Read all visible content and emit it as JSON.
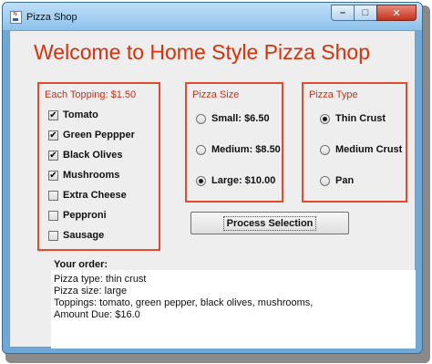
{
  "window": {
    "title": "Pizza Shop",
    "controls": {
      "minimize": "–",
      "maximize": "□",
      "close": "✕"
    },
    "colors": {
      "accent": "#d8300a",
      "panel_border": "#e24b2c"
    }
  },
  "welcome": "Welcome to Home Style Pizza Shop",
  "toppings": {
    "title": "Each Topping: $1.50",
    "items": [
      {
        "label": "Tomato",
        "checked": true
      },
      {
        "label": "Green Peppper",
        "checked": true
      },
      {
        "label": "Black Olives",
        "checked": true
      },
      {
        "label": "Mushrooms",
        "checked": true
      },
      {
        "label": "Extra Cheese",
        "checked": false
      },
      {
        "label": "Pepproni",
        "checked": false
      },
      {
        "label": "Sausage",
        "checked": false
      }
    ]
  },
  "size": {
    "title": "Pizza Size",
    "options": [
      {
        "label": "Small: $6.50",
        "selected": false
      },
      {
        "label": "Medium: $8.50",
        "selected": false
      },
      {
        "label": "Large: $10.00",
        "selected": true
      }
    ]
  },
  "type": {
    "title": "Pizza Type",
    "options": [
      {
        "label": "Thin Crust",
        "selected": true
      },
      {
        "label": "Medium Crust",
        "selected": false
      },
      {
        "label": "Pan",
        "selected": false
      }
    ]
  },
  "process_button": "Process Selection",
  "order": {
    "label": "Your order:",
    "lines": [
      "Pizza type: thin crust",
      "Pizza size: large",
      "Toppings: tomato, green pepper, black olives, mushrooms,",
      "Amount Due: $16.0"
    ]
  }
}
